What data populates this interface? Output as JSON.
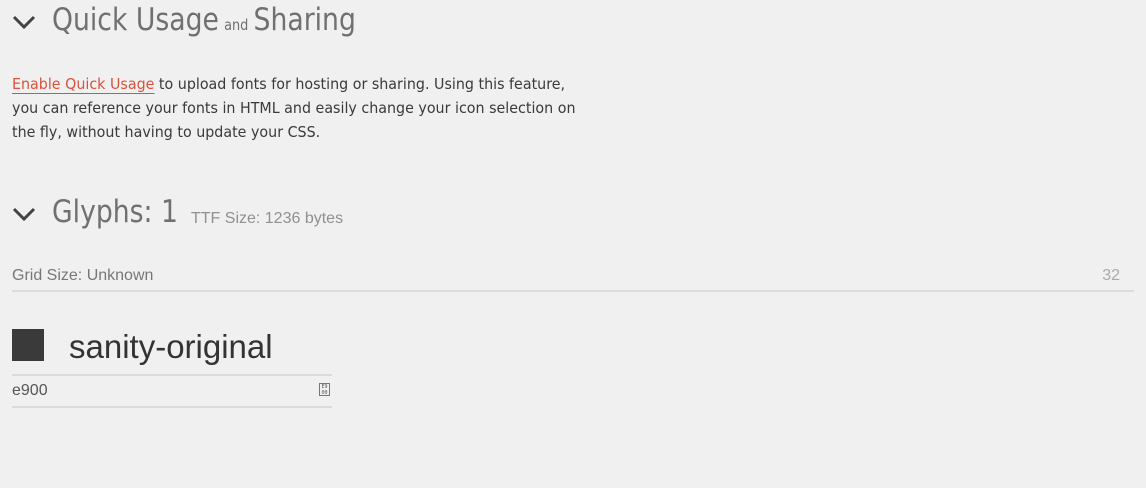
{
  "quick_usage": {
    "title_part1": "Quick Usage",
    "title_and": "and",
    "title_part2": "Sharing",
    "link_text": "Enable Quick Usage",
    "description": " to upload fonts for hosting or sharing. Using this feature, you can reference your fonts in HTML and easily change your icon selection on the fly, without having to update your CSS.",
    "collapse_icon": "chevron-down-icon"
  },
  "glyphs": {
    "title": "Glyphs: 1",
    "ttf_size": "TTF Size: 1236 bytes",
    "collapse_icon": "chevron-down-icon",
    "grid_size_label": "Grid Size: Unknown",
    "grid_size_value": "32",
    "items": [
      {
        "name": "sanity-original",
        "code": "e900",
        "code_icon_text": "E9 00",
        "preview_color": "#3a3a3a"
      }
    ]
  },
  "colors": {
    "link": "#d9523b",
    "background": "#f0f0f0"
  }
}
